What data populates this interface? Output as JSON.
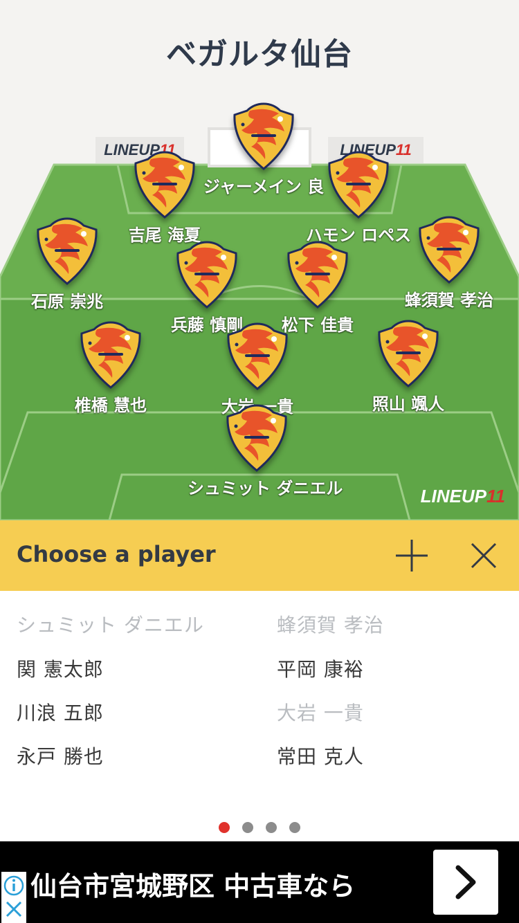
{
  "header": {
    "team_name": "ベガルタ仙台"
  },
  "branding": {
    "logo_word": "LINEUP",
    "logo_num": "11"
  },
  "colors": {
    "pitch_green": "#6aaf4f",
    "accent_yellow": "#f6cd52",
    "active_dot": "#e0322c",
    "crest_orange": "#e8542a",
    "crest_gold": "#f3bf3a",
    "crest_navy": "#1f2a5c"
  },
  "lineup": [
    {
      "name": "ジャーメイン 良"
    },
    {
      "name": "吉尾 海夏"
    },
    {
      "name": "ハモン ロペス"
    },
    {
      "name": "石原 崇兆"
    },
    {
      "name": "兵藤 慎剛"
    },
    {
      "name": "松下 佳貴"
    },
    {
      "name": "蜂須賀 孝治"
    },
    {
      "name": "椎橋 慧也"
    },
    {
      "name": "大岩 一貴"
    },
    {
      "name": "照山 颯人"
    },
    {
      "name": "シュミット ダニエル"
    }
  ],
  "chooser": {
    "title": "Choose a player",
    "add_icon": "plus-icon",
    "close_icon": "close-icon",
    "players": [
      {
        "name": "シュミット ダニエル",
        "selected": true
      },
      {
        "name": "蜂須賀 孝治",
        "selected": true
      },
      {
        "name": "関 憲太郎",
        "selected": false
      },
      {
        "name": "平岡 康裕",
        "selected": false
      },
      {
        "name": "川浪 五郎",
        "selected": false
      },
      {
        "name": "大岩 一貴",
        "selected": true
      },
      {
        "name": "永戸 勝也",
        "selected": false
      },
      {
        "name": "常田 克人",
        "selected": false
      }
    ],
    "pagination": {
      "current": 1,
      "total": 4
    }
  },
  "ad": {
    "text": "仙台市宮城野区 中古車なら",
    "info_icon": "info-icon",
    "close_icon": "ad-close-icon",
    "arrow_icon": "chevron-right-icon"
  }
}
